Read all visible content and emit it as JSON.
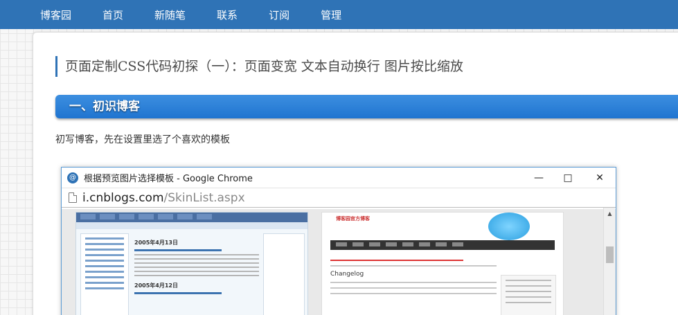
{
  "topnav": {
    "items": [
      "博客园",
      "首页",
      "新随笔",
      "联系",
      "订阅",
      "管理"
    ]
  },
  "post": {
    "title": "页面定制CSS代码初探（一）：页面变宽 文本自动换行 图片按比缩放",
    "section_heading": "一、初识博客",
    "paragraph": "初写博客，先在设置里选了个喜欢的模板"
  },
  "chrome_window": {
    "title": "根据预览图片选择模板 - Google Chrome",
    "url_host": "i.cnblogs.com",
    "url_path": "/SkinList.aspx",
    "logo_glyph": "@"
  },
  "thumb_left": {
    "date1": "2005年4月13日",
    "date2": "2005年4月12日"
  },
  "thumb_right": {
    "site_title": "博客园官方博客",
    "heading": "Changelog"
  },
  "colors": {
    "nav_bg": "#2f73b6",
    "section_bar": "#1f74d0",
    "title_accent": "#2f73b6"
  }
}
